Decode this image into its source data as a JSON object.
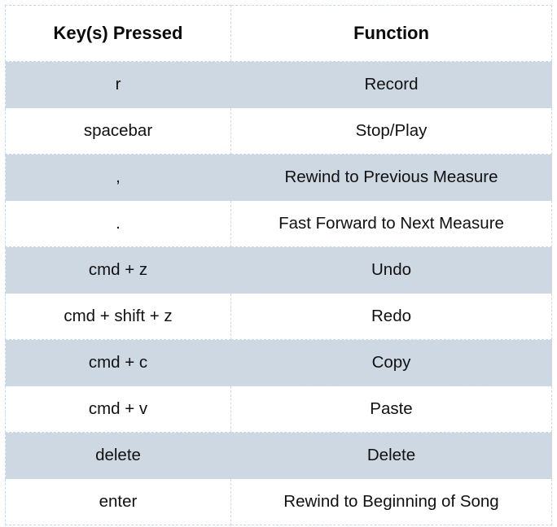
{
  "table": {
    "name": "keyboard-shortcuts-table",
    "columns": [
      {
        "key": "keys",
        "label": "Key(s) Pressed"
      },
      {
        "key": "function",
        "label": "Function"
      }
    ],
    "rows": [
      {
        "keys": "r",
        "function": "Record",
        "shaded": true
      },
      {
        "keys": "spacebar",
        "function": "Stop/Play",
        "shaded": false
      },
      {
        "keys": ",",
        "function": "Rewind to Previous Measure",
        "shaded": true
      },
      {
        "keys": ".",
        "function": "Fast Forward to Next Measure",
        "shaded": false
      },
      {
        "keys": "cmd + z",
        "function": "Undo",
        "shaded": true
      },
      {
        "keys": "cmd + shift + z",
        "function": "Redo",
        "shaded": false
      },
      {
        "keys": "cmd + c",
        "function": "Copy",
        "shaded": true
      },
      {
        "keys": "cmd + v",
        "function": "Paste",
        "shaded": false
      },
      {
        "keys": "delete",
        "function": "Delete",
        "shaded": true
      },
      {
        "keys": "enter",
        "function": "Rewind to Beginning of Song",
        "shaded": false
      }
    ]
  },
  "colors": {
    "row_shaded": "#ced8e2",
    "row_plain": "#ffffff",
    "grid_line": "#c9d9e8",
    "text": "#111111",
    "page_background": "#ffffff"
  }
}
